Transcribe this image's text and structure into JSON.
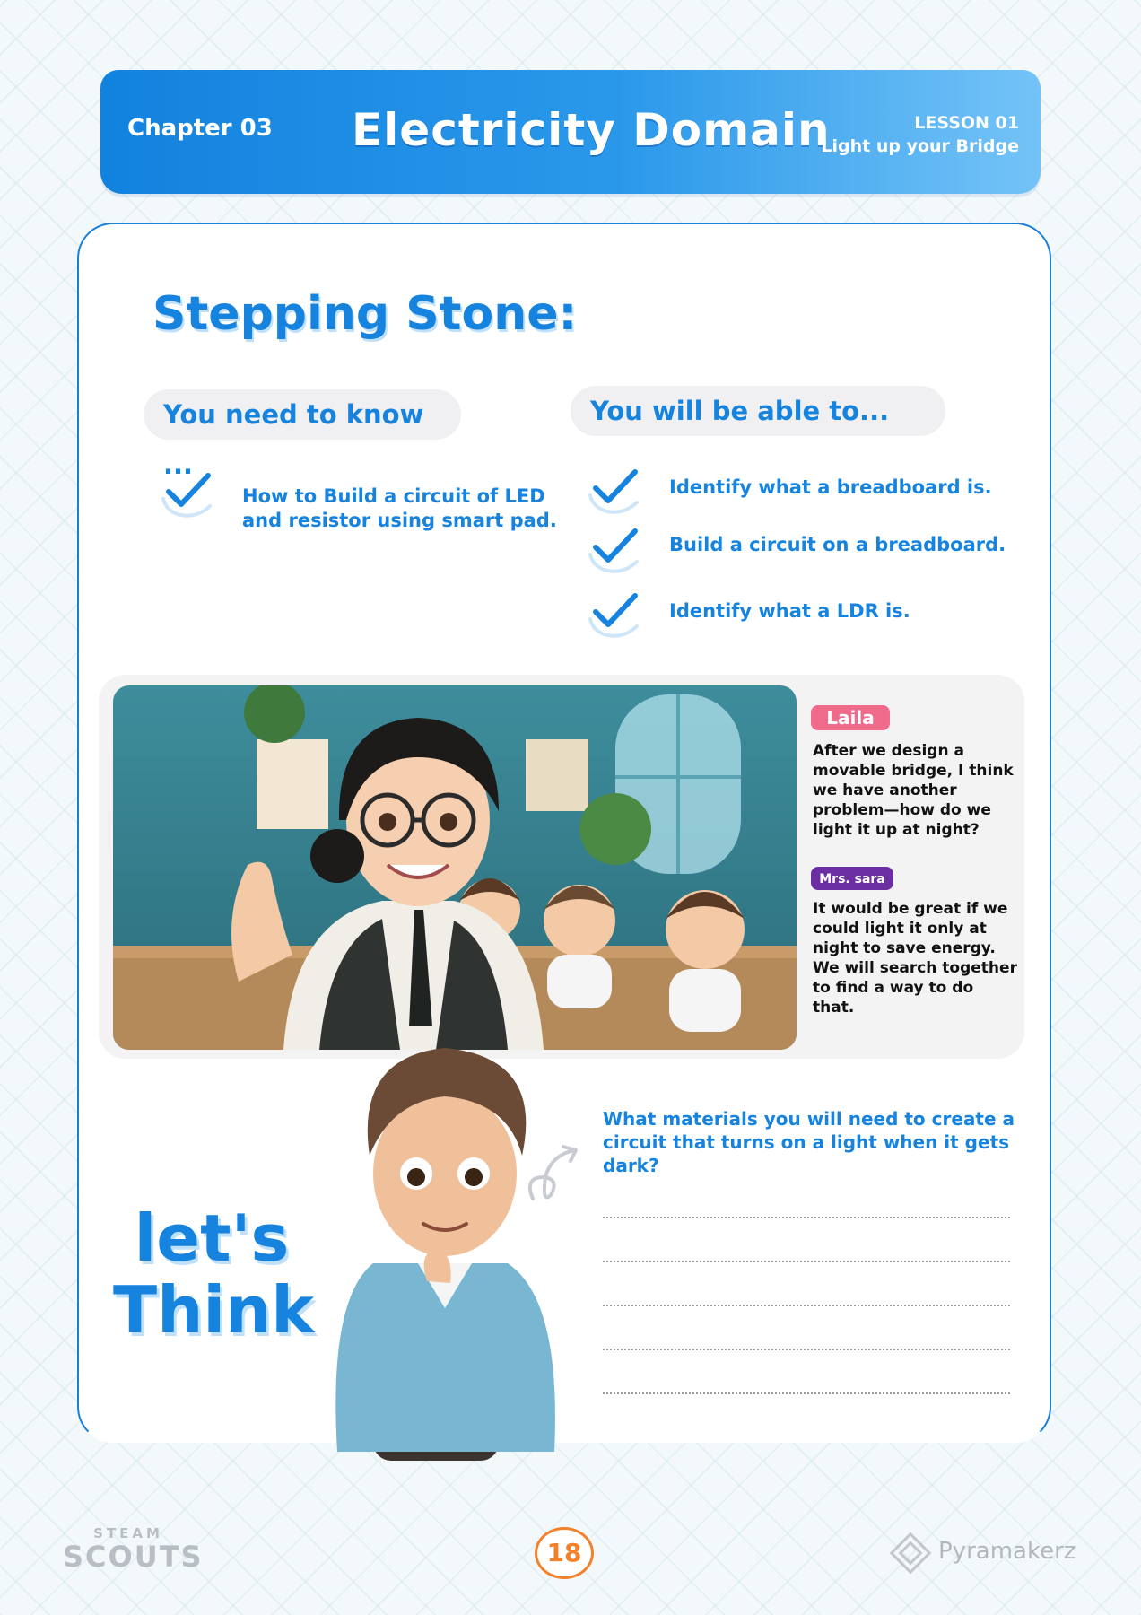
{
  "header": {
    "chapter": "Chapter 03",
    "title": "Electricity Domain",
    "lesson_label": "LESSON 01",
    "lesson_title": "Light up your Bridge"
  },
  "section": {
    "title": "Stepping Stone:",
    "need_to_know": {
      "label": "You need to know ...",
      "items": [
        "How to Build a circuit of LED and resistor using smart pad."
      ]
    },
    "able_to": {
      "label": "You will be able to...",
      "items": [
        "Identify what a breadboard is.",
        "Build a circuit on a breadboard.",
        "Identify what a LDR is."
      ]
    }
  },
  "dialogue": [
    {
      "speaker": "Laila",
      "text": "After we design a movable bridge, I think we have another problem—how do we light it up at night?",
      "color": "#f06a8c"
    },
    {
      "speaker": "Mrs. sara",
      "text": "It would be great if we could light it only at night to save energy. We will search together to find a way to do that.",
      "color": "#6b2fa1"
    }
  ],
  "think": {
    "title_line1": "let's",
    "title_line2": "Think",
    "question": "What materials you will need to create a circuit that turns on a light when it gets dark?"
  },
  "footer": {
    "page_number": "18",
    "logo_left_small": "STEAM",
    "logo_left_big": "SCOUTS",
    "logo_right": "Pyramakerz"
  },
  "colors": {
    "accent": "#1683de",
    "page_number": "#f2812a"
  }
}
